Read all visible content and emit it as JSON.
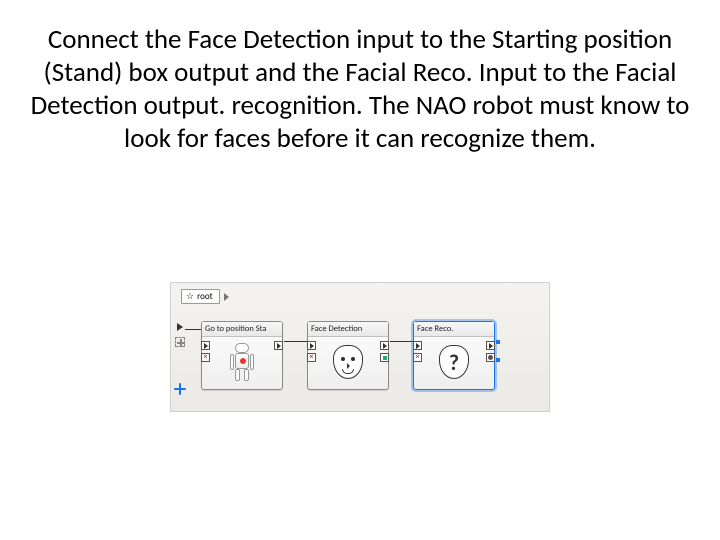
{
  "paragraph": "Connect the Face Detection input to the Starting position (Stand) box output and the Facial Reco. Input to the Facial Detection output. recognition.   The NAO robot must know to look for faces before it can recognize them.",
  "breadcrumb": {
    "root_label": "root"
  },
  "nodes": [
    {
      "title": "Go to position Sta",
      "icon": "robot",
      "selected": false
    },
    {
      "title": "Face Detection",
      "icon": "face",
      "selected": false
    },
    {
      "title": "Face Reco.",
      "icon": "faceq",
      "selected": true
    }
  ]
}
